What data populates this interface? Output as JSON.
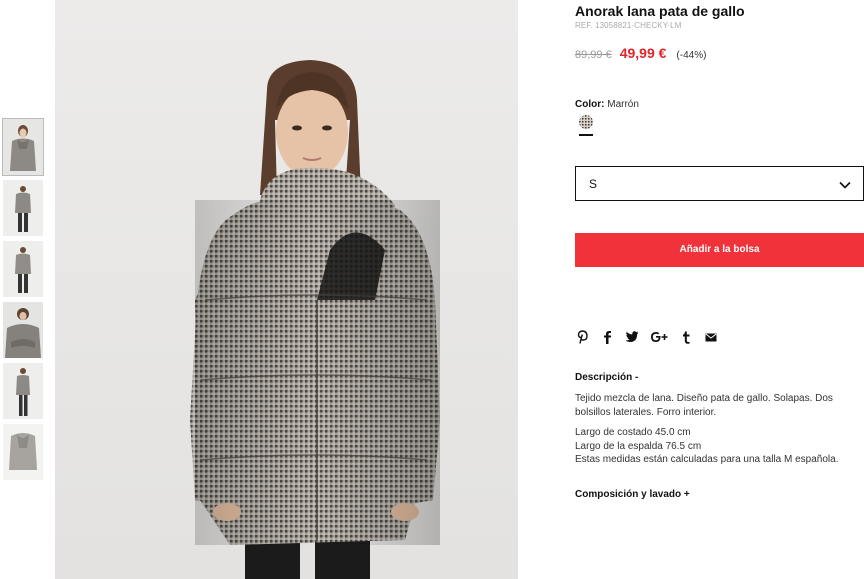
{
  "product": {
    "title": "Anorak lana pata de gallo",
    "ref": "REF. 13058821-CHECKY-LM",
    "old_price": "89,99 €",
    "new_price": "49,99 €",
    "discount": "(-44%)"
  },
  "color": {
    "label": "Color:",
    "value": "Marrón"
  },
  "size": {
    "selected": "S",
    "icon": "chevron-down-icon"
  },
  "actions": {
    "add_to_bag": "Añadir a la bolsa"
  },
  "share": {
    "icons": [
      "pinterest-icon",
      "facebook-icon",
      "twitter-icon",
      "google-plus-icon",
      "tumblr-icon",
      "email-icon"
    ]
  },
  "description": {
    "heading": "Descripción -",
    "text": "Tejido mezcla de lana. Diseño pata de gallo. Solapas. Dos bolsillos laterales. Forro interior.",
    "measure_1": "Largo de costado 45.0 cm",
    "measure_2": "Largo de la espalda 76.5 cm",
    "measure_3": "Estas medidas están calculadas para una talla M española."
  },
  "composition": {
    "heading": "Composición y lavado +"
  },
  "colors": {
    "accent": "#f0323b",
    "sale_price": "#e2242b"
  }
}
